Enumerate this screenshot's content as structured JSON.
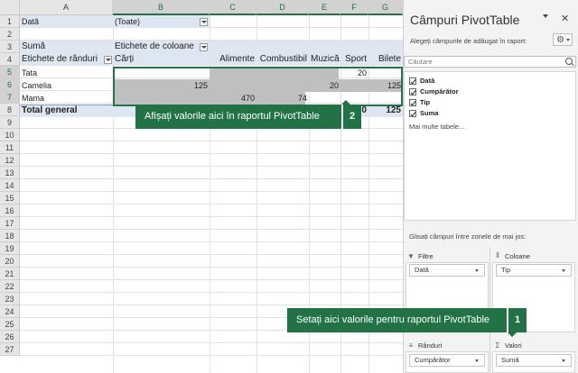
{
  "sheet": {
    "columns": [
      "A",
      "B",
      "C",
      "D",
      "E",
      "F",
      "G"
    ],
    "rows": [
      "1",
      "2",
      "3",
      "4",
      "5",
      "6",
      "7",
      "8",
      "9",
      "10",
      "11",
      "12",
      "13",
      "14",
      "15",
      "16",
      "17",
      "18",
      "19",
      "20",
      "21",
      "22",
      "23",
      "24",
      "25",
      "26",
      "27"
    ],
    "filter": {
      "label": "Dată",
      "value": "(Toate)"
    },
    "pivot": {
      "values_label": "Sumă",
      "col_labels_caption": "Etichete de coloane",
      "row_labels_caption": "Etichete de rânduri",
      "headers": [
        "Cărți",
        "Alimente",
        "Combustibil",
        "Muzică",
        "Sport",
        "Bilete"
      ],
      "rows": [
        {
          "label": "Tata",
          "cells": [
            "",
            "",
            "",
            "",
            "20",
            ""
          ]
        },
        {
          "label": "Camelia",
          "cells": [
            "125",
            "",
            "",
            "20",
            "",
            "125"
          ]
        },
        {
          "label": "Mama",
          "cells": [
            "",
            "470",
            "74",
            "",
            "",
            ""
          ]
        }
      ],
      "total": {
        "label": "Total general",
        "cells": [
          "",
          "",
          "",
          "",
          "0",
          "125"
        ]
      }
    }
  },
  "callouts": {
    "top": {
      "text": "Afișați valorile aici în raportul PivotTable",
      "number": "2"
    },
    "bottom": {
      "text": "Setați aici valorile pentru raportul PivotTable",
      "number": "1"
    }
  },
  "pane": {
    "title": "Câmpuri PivotTable",
    "choose_label": "Alegeți câmpurile de adăugat în raport:",
    "search_placeholder": "Căutare",
    "fields": [
      {
        "label": "Dată",
        "checked": true
      },
      {
        "label": "Cumpărător",
        "checked": true
      },
      {
        "label": "Tip",
        "checked": true
      },
      {
        "label": "Suma",
        "checked": true
      }
    ],
    "more_tables": "Mai multe tabele...",
    "drag_label": "Glisați câmpuri între zonele de mai jos:",
    "zones": {
      "filters": {
        "title": "Filtre",
        "item": "Dată",
        "icon": "filter-icon"
      },
      "columns": {
        "title": "Coloane",
        "item": "Tip",
        "icon": "columns-icon"
      },
      "rows": {
        "title": "Rânduri",
        "item": "Cumpărător",
        "icon": "rows-icon"
      },
      "values": {
        "title": "Valori",
        "item": "Sumă",
        "icon": "sigma-icon"
      }
    }
  }
}
